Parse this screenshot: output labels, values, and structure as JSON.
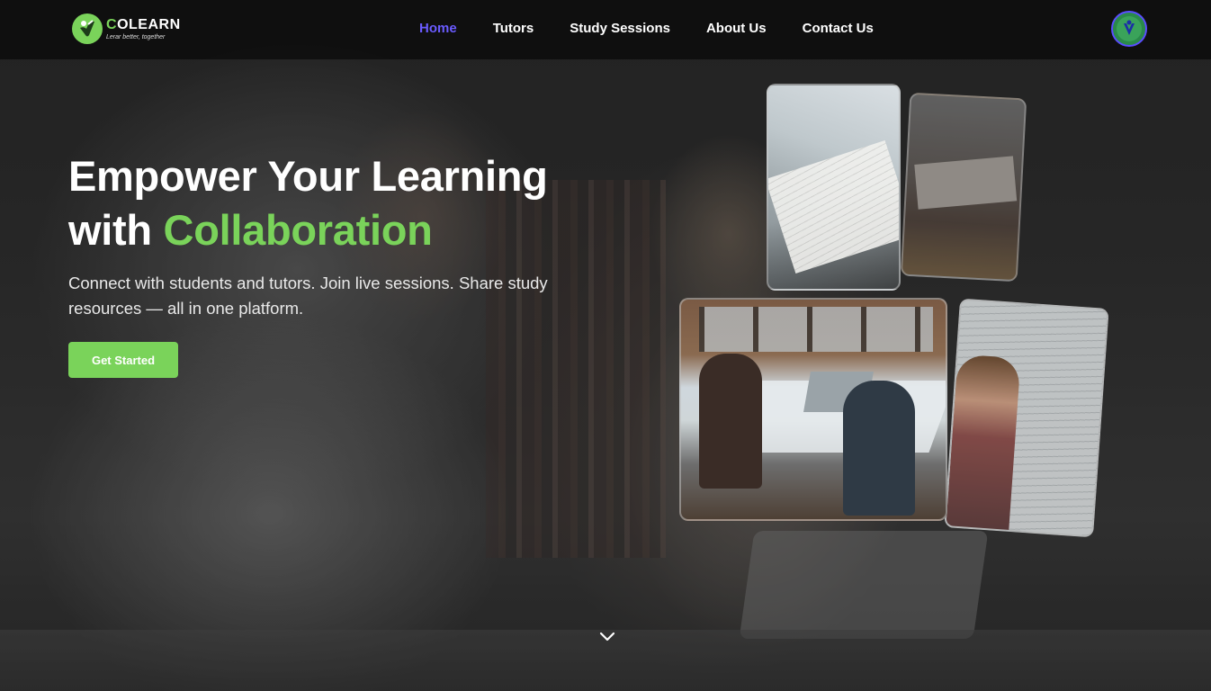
{
  "brand": {
    "name_first_letter": "C",
    "name_rest": "OLEARN",
    "tagline": "Lerar better, together",
    "accent_color": "#7ad35a",
    "nav_active_color": "#6a5bff"
  },
  "nav": {
    "items": [
      {
        "label": "Home",
        "active": true
      },
      {
        "label": "Tutors",
        "active": false
      },
      {
        "label": "Study Sessions",
        "active": false
      },
      {
        "label": "About Us",
        "active": false
      },
      {
        "label": "Contact Us",
        "active": false
      }
    ]
  },
  "hero": {
    "title_line1": "Empower Your Learning",
    "title_line2_prefix": "with ",
    "title_line2_accent": "Collaboration",
    "subtitle": "Connect with students and tutors. Join live sessions. Share study resources — all in one platform.",
    "cta_label": "Get Started"
  },
  "icons": {
    "logo": "colearn-logo-icon",
    "avatar": "user-avatar-icon",
    "scroll": "chevron-down-icon"
  }
}
